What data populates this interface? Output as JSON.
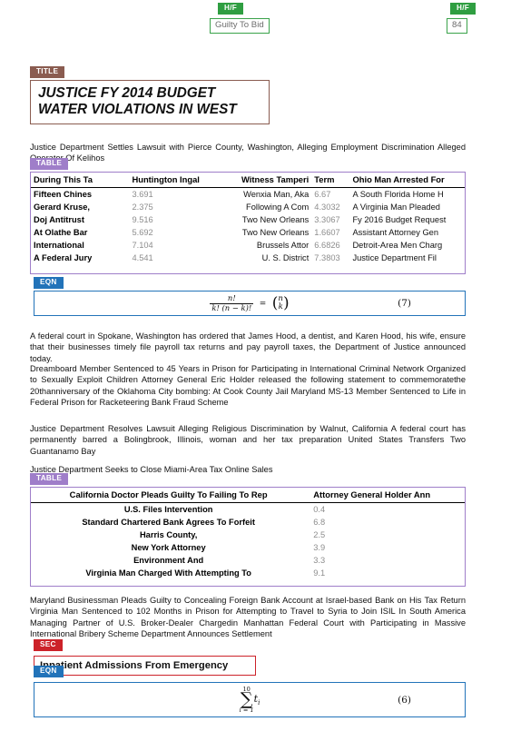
{
  "header_footer": [
    {
      "tag": "H/F",
      "value": "Guilty To Bid"
    },
    {
      "tag": "H/F",
      "value": "84"
    }
  ],
  "title_block": {
    "tag": "TITLE",
    "text": "JUSTICE FY 2014 BUDGET\nWATER VIOLATIONS IN WEST"
  },
  "paragraphs": {
    "p1": "Justice Department Settles Lawsuit with Pierce County, Washington, Alleging Employment Discrimination Alleged Operator Of Kelihos",
    "p2": "A federal court in Spokane, Washington has ordered that James Hood, a dentist, and Karen Hood, his wife, ensure that their businesses timely file payroll tax returns and pay payroll taxes, the Department of Justice announced today.",
    "p3": "Dreamboard Member Sentenced to 45 Years in Prison for Participating in International Criminal Network Organized to Sexually Exploit Children Attorney General Eric Holder released the following statement to commemoratethe 20thanniversary of the Oklahoma City bombing: At Cook County Jail Maryland MS-13 Member Sentenced to Life in Federal Prison for Racketeering Bank Fraud Scheme",
    "p4": "Justice Department Resolves Lawsuit Alleging Religious Discrimination by Walnut, California A federal court has permanently barred a Bolingbrook, Illinois, woman and her tax preparation United States Transfers Two Guantanamo Bay",
    "p5": "Justice Department Seeks to Close Miami-Area Tax Online Sales",
    "p6": "Maryland Businessman Pleads Guilty to Concealing Foreign Bank Account at Israel-based Bank on His Tax Return Virginia Man Sentenced to 102 Months in Prison for Attempting to Travel to Syria to Join ISIL In South America Managing Partner of U.S. Broker-Dealer Chargedin Manhattan Federal Court with Participating in Massive International Bribery Scheme Department Announces Settlement"
  },
  "table1": {
    "tag": "TABLE",
    "headers": [
      "During This Ta",
      "Huntington Ingal",
      "Witness Tamperi",
      "Term",
      "Ohio Man Arrested For"
    ],
    "rows": [
      [
        "Fifteen Chines",
        "3.691",
        "Wenxia Man, Aka",
        "6.67",
        "A South Florida Home H"
      ],
      [
        "Gerard Kruse,",
        "2.375",
        "Following A Com",
        "4.3032",
        "A Virginia Man Pleaded"
      ],
      [
        "Doj Antitrust",
        "9.516",
        "Two New Orleans",
        "3.3067",
        "Fy 2016 Budget Request"
      ],
      [
        "At Olathe Bar",
        "5.692",
        "Two New Orleans",
        "1.6607",
        "Assistant Attorney Gen"
      ],
      [
        "International",
        "7.104",
        "Brussels  Attor",
        "6.6826",
        "Detroit-Area Men Charg"
      ],
      [
        "A Federal Jury",
        "4.541",
        "U. S. District",
        "7.3803",
        "Justice Department Fil"
      ]
    ]
  },
  "table2": {
    "tag": "TABLE",
    "headers": [
      "California Doctor Pleads Guilty To Failing To Rep",
      "Attorney General Holder Ann"
    ],
    "rows": [
      [
        "U.S. Files Intervention",
        "0.4"
      ],
      [
        "Standard Chartered Bank Agrees To Forfeit",
        "6.8"
      ],
      [
        "Harris County,",
        "2.5"
      ],
      [
        "New York Attorney",
        "3.9"
      ],
      [
        "Environment And",
        "3.3"
      ],
      [
        "Virginia Man Charged With Attempting To",
        "9.1"
      ]
    ]
  },
  "equation1": {
    "tag": "EQN",
    "number": "(7)",
    "numerator": "n!",
    "denominator": "k! (n − k)!",
    "equals": "=",
    "binom_top": "n",
    "binom_bottom": "k"
  },
  "equation2": {
    "tag": "EQN",
    "number": "(6)",
    "sum_upper": "10",
    "sum_symbol": "∑",
    "sum_lower": "i = 1",
    "summand": "t",
    "summand_sub": "i"
  },
  "section": {
    "tag": "SEC",
    "heading": "Inpatient Admissions From Emergency"
  },
  "colors": {
    "hf": "#2f9e41",
    "title": "#8a5c50",
    "table": "#9f7ec9",
    "eqn": "#2273b9",
    "sec": "#cc2229",
    "number_text": "#8d8d8d"
  }
}
